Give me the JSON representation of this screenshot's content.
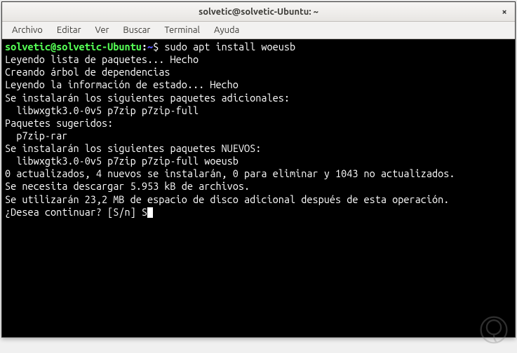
{
  "window": {
    "title": "solvetic@solvetic-Ubuntu: ~",
    "close_label": "×"
  },
  "menubar": {
    "items": [
      "Archivo",
      "Editar",
      "Ver",
      "Buscar",
      "Terminal",
      "Ayuda"
    ]
  },
  "prompt": {
    "userhost": "solvetic@solvetic-Ubuntu",
    "sep": ":",
    "path": "~",
    "dollar": "$"
  },
  "command": "sudo apt install woeusb",
  "output_lines": [
    "Leyendo lista de paquetes... Hecho",
    "Creando árbol de dependencias",
    "Leyendo la información de estado... Hecho",
    "Se instalarán los siguientes paquetes adicionales:",
    "  libwxgtk3.0-0v5 p7zip p7zip-full",
    "Paquetes sugeridos:",
    "  p7zip-rar",
    "Se instalarán los siguientes paquetes NUEVOS:",
    "  libwxgtk3.0-0v5 p7zip p7zip-full woeusb",
    "0 actualizados, 4 nuevos se instalarán, 0 para eliminar y 1043 no actualizados.",
    "Se necesita descargar 5.953 kB de archivos.",
    "Se utilizarán 23,2 MB de espacio de disco adicional después de esta operación."
  ],
  "confirm": {
    "question": "¿Desea continuar? [S/n] ",
    "answer": "S"
  }
}
